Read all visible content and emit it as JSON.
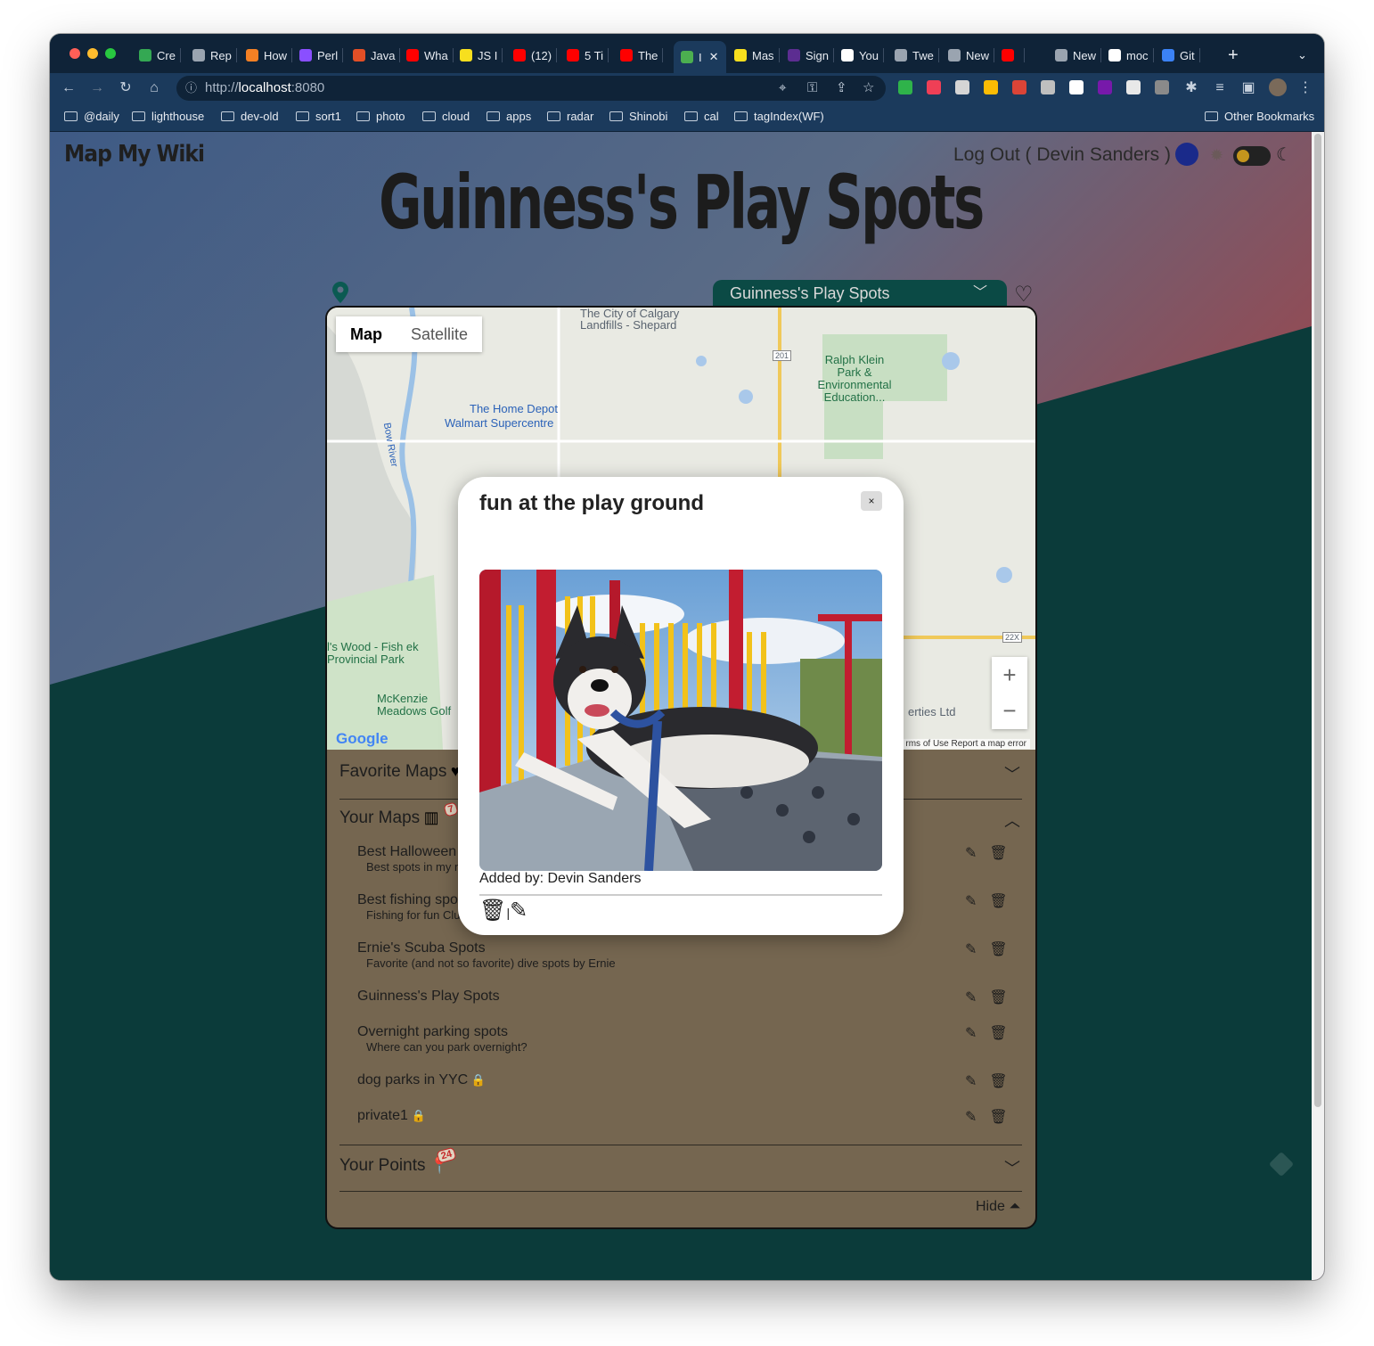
{
  "browser": {
    "tabs": [
      {
        "label": "Cre",
        "color": "#34a853"
      },
      {
        "label": "Rep",
        "color": "#9aa4b0"
      },
      {
        "label": "How",
        "color": "#f48024"
      },
      {
        "label": "Perl",
        "color": "#8a4fff"
      },
      {
        "label": "Java",
        "color": "#e34f26"
      },
      {
        "label": "Wha",
        "color": "#ff0000"
      },
      {
        "label": "JS I",
        "color": "#f7df1e"
      },
      {
        "label": "(12)",
        "color": "#ff0000"
      },
      {
        "label": "5 Ti",
        "color": "#ff0000"
      },
      {
        "label": "The",
        "color": "#ff0000"
      },
      {
        "label": "I",
        "color": "#4caf50",
        "active": true
      },
      {
        "label": "Mas",
        "color": "#f7df1e"
      },
      {
        "label": "Sign",
        "color": "#5c2d91"
      },
      {
        "label": "You",
        "color": "#ffffff"
      },
      {
        "label": "Twe",
        "color": "#9aa4b0"
      },
      {
        "label": "New",
        "color": "#9aa4b0"
      },
      {
        "label": "",
        "color": "#ff0000"
      },
      {
        "label": "New",
        "color": "#9aa4b0"
      },
      {
        "label": "moc",
        "color": "#ffffff"
      },
      {
        "label": "Git",
        "color": "#3b82f6"
      }
    ],
    "url_prefix": "http://",
    "url_host": "localhost",
    "url_port": ":8080",
    "bookmarks": [
      "@daily",
      "lighthouse",
      "dev-old",
      "sort1",
      "photo",
      "cloud",
      "apps",
      "radar",
      "Shinobi",
      "cal",
      "tagIndex(WF)"
    ],
    "other_bookmarks": "Other Bookmarks"
  },
  "app": {
    "brand": "Map My Wiki",
    "logout": "Log Out ( Devin Sanders )",
    "map_title": "Guinness's Play Spots",
    "selected_map": "Guinness's Play Spots",
    "map_type_map": "Map",
    "map_type_satellite": "Satellite",
    "map_labels": {
      "landfill": "The City of Calgary Landfills - Shepard",
      "ralph": "Ralph Klein Park & Environmental Education...",
      "homedepot": "The Home Depot",
      "walmart": "Walmart Supercentre",
      "bowriver": "Bow River",
      "fishcreek": "l's Wood - Fish ek Provincial Park",
      "mckenzie": "McKenzie Meadows Golf",
      "properties": "erties Ltd",
      "hwy201": "201",
      "hwy22x": "22X"
    },
    "map_footer": "rms of Use   Report a map error",
    "google": "Google",
    "sections": {
      "favorite": "Favorite Maps",
      "yours": "Your Maps",
      "yours_badge": "7",
      "points": "Your Points",
      "points_badge": "24"
    },
    "maps": [
      {
        "name": "Best Halloween",
        "desc": "Best spots in my n"
      },
      {
        "name": "Best fishing spo",
        "desc": "Fishing for fun Clu"
      },
      {
        "name": "Ernie's Scuba Spots",
        "desc": "Favorite (and not so favorite) dive spots by Ernie"
      },
      {
        "name": "Guinness's Play Spots",
        "desc": ""
      },
      {
        "name": "Overnight parking spots",
        "desc": "Where can you park overnight?"
      },
      {
        "name": "dog parks in YYC",
        "desc": "",
        "locked": true
      },
      {
        "name": "private1",
        "desc": "",
        "locked": true
      }
    ],
    "hide": "Hide"
  },
  "modal": {
    "title": "fun at the play ground",
    "close": "×",
    "added_by": "Added by: Devin Sanders",
    "separator": "|"
  }
}
